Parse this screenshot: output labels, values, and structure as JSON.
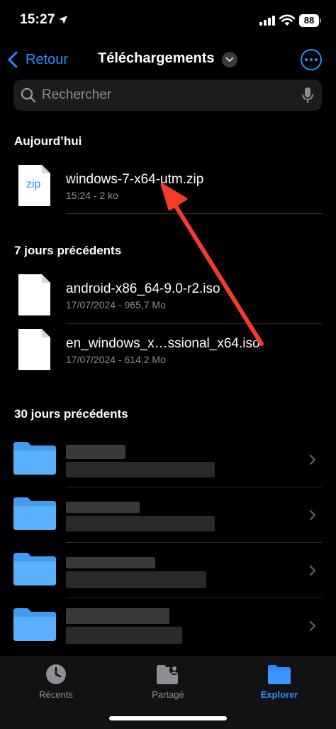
{
  "status": {
    "time": "15:27",
    "battery": "88"
  },
  "nav": {
    "back_label": "Retour",
    "title": "Téléchargements"
  },
  "search": {
    "placeholder": "Rechercher"
  },
  "sections": {
    "today": {
      "header": "Aujourd’hui",
      "files": [
        {
          "name": "windows-7-x64-utm.zip",
          "meta": "15:24 - 2 ko",
          "thumb_label": "zip"
        }
      ]
    },
    "week": {
      "header": "7 jours précédents",
      "files": [
        {
          "name": "android-x86_64-9.0-r2.iso",
          "meta": "17/07/2024 - 965,7 Mo"
        },
        {
          "name": "en_windows_x…ssional_x64.iso",
          "meta": "17/07/2024 - 614,2 Mo"
        }
      ]
    },
    "month": {
      "header": "30 jours précédents"
    }
  },
  "tabs": [
    {
      "label": "Récents",
      "icon": "clock-icon"
    },
    {
      "label": "Partagé",
      "icon": "shared-folder-icon"
    },
    {
      "label": "Explorer",
      "icon": "folder-icon"
    }
  ],
  "colors": {
    "accent": "#2f8cff",
    "arrow": "#f53b2b",
    "folder": "#3f9cf0"
  }
}
